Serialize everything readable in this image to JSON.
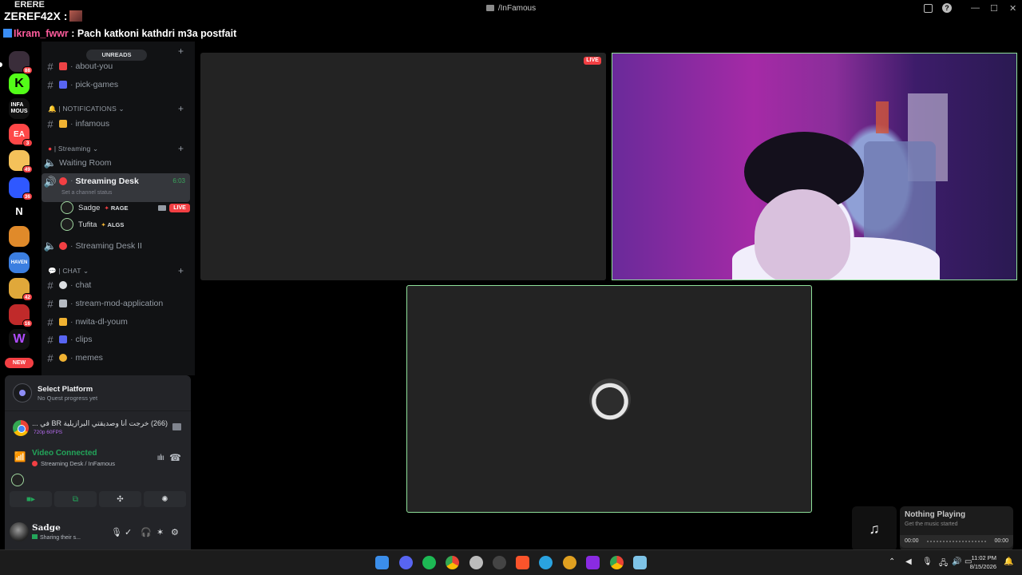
{
  "window": {
    "title": "/InFamous"
  },
  "overlay": {
    "top_text": "ERERE",
    "username_line": "ZEREF42X :",
    "chat_user": "Ikram_fwwr",
    "chat_message": " : Pach katkoni kathdri m3a postfait"
  },
  "server_rail": {
    "items": [
      {
        "icon": "server-icon",
        "badge": "88",
        "color": "#3a2d3a"
      },
      {
        "icon": "kick-icon",
        "badge": "",
        "color": "#53fc18"
      },
      {
        "icon": "infamous-icon",
        "badge": "",
        "color": "#111"
      },
      {
        "icon": "ea-icon",
        "badge": "3",
        "color": "#ff4747"
      },
      {
        "icon": "server-icon",
        "badge": "49",
        "color": "#f4c15a"
      },
      {
        "icon": "server-icon",
        "badge": "36",
        "color": "#2f58ff"
      },
      {
        "icon": "n-icon",
        "badge": "",
        "color": "#000"
      },
      {
        "icon": "server-icon",
        "badge": "",
        "color": "#e08a2a"
      },
      {
        "icon": "haven-icon",
        "badge": "",
        "color": "#3b7ee0"
      },
      {
        "icon": "server-icon",
        "badge": "42",
        "color": "#e0a83a"
      },
      {
        "icon": "server-icon",
        "badge": "16",
        "color": "#c02a2a"
      },
      {
        "icon": "w-icon",
        "badge": "",
        "color": "#8b2ad6"
      }
    ],
    "new_label": "NEW"
  },
  "channels": {
    "unreads": "UNREADS",
    "items": [
      {
        "name": "about-you",
        "emoji_color": "#ed4245"
      },
      {
        "name": "pick-games",
        "emoji_color": "#5865f2"
      }
    ],
    "cat_notifications": "NOTIFICATIONS",
    "infamous": "infamous",
    "cat_streaming": "| Streaming",
    "waiting_room": "Waiting Room",
    "streaming_desk": "Streaming Desk",
    "streaming_desk_time": "6:03",
    "channel_status": "Set a channel status",
    "voice_users": [
      {
        "name": "Sadge",
        "tag": "RAGE",
        "live": "LIVE"
      },
      {
        "name": "Tufita",
        "tag": "ALGS"
      }
    ],
    "streaming_desk_2": "Streaming Desk II",
    "cat_chat": "CHAT",
    "chat_channels": [
      "chat",
      "stream-mod-application",
      "nwita-dl-youm",
      "clips",
      "memes"
    ]
  },
  "quest": {
    "title": "Select Platform",
    "subtitle": "No Quest progress yet"
  },
  "activity": {
    "title": "(266) خرجت أنا وصديقتي البرازيلية BR في ...",
    "subtitle": "720p 60FPS"
  },
  "voice": {
    "status": "Video Connected",
    "location": "Streaming Desk / InFamous"
  },
  "user": {
    "name": "Sadge",
    "status": "Sharing their s..."
  },
  "stage": {
    "live_label": "LIVE"
  },
  "music": {
    "title": "Nothing Playing",
    "subtitle": "Get the music started",
    "time_start": "00:00",
    "time_end": "00:00"
  },
  "taskbar": {
    "time": "11:02 PM",
    "date": "8/15/2026",
    "apps": [
      {
        "icon": "start-icon",
        "color": "#3b8eea"
      },
      {
        "icon": "discord-icon",
        "color": "#5865f2"
      },
      {
        "icon": "spotify-icon",
        "color": "#1db954"
      },
      {
        "icon": "chrome-icon",
        "color": "#e8a12a"
      },
      {
        "icon": "obs-icon",
        "color": "#bcbcbc"
      },
      {
        "icon": "app-icon",
        "color": "#d33"
      },
      {
        "icon": "brave-icon",
        "color": "#fb542b"
      },
      {
        "icon": "telegram-icon",
        "color": "#2aa3e0"
      },
      {
        "icon": "app-icon",
        "color": "#e0a020"
      },
      {
        "icon": "app-icon",
        "color": "#8a2be2"
      },
      {
        "icon": "chrome-icon",
        "color": "#4caf50"
      },
      {
        "icon": "app-icon",
        "color": "#7ec3e6"
      }
    ]
  }
}
